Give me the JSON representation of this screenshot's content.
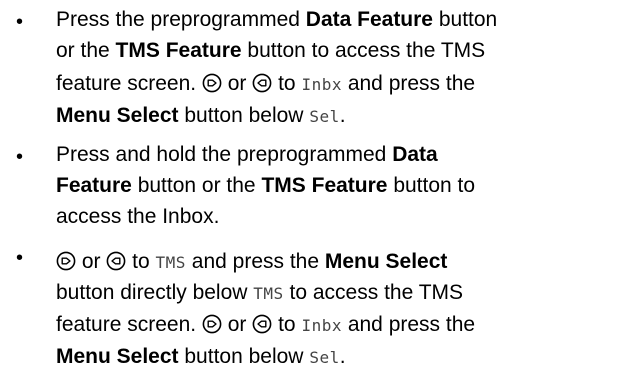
{
  "bullet_char": "•",
  "item1": {
    "l1": {
      "a": "Press the preprogrammed ",
      "b": "Data Feature",
      "c": " button"
    },
    "l2": {
      "a": "or the ",
      "b": "TMS Feature",
      "c": " button to access the TMS"
    },
    "l3": {
      "a": "feature screen. ",
      "or": " or ",
      "to": " to ",
      "code": "Inbx",
      "rest": " and press the"
    },
    "l4": {
      "b": "Menu Select",
      "a": " button below ",
      "code": "Sel",
      "end": "."
    }
  },
  "item2": {
    "l1": {
      "a": "Press and hold the preprogrammed ",
      "b": "Data"
    },
    "l2": {
      "b": "Feature",
      "a": " button or the ",
      "b2": "TMS Feature",
      "c": " button to"
    },
    "l3": {
      "a": "access the Inbox."
    }
  },
  "item3": {
    "l1": {
      "or": " or ",
      "to": " to ",
      "code": "TMS",
      "a": " and press the ",
      "b": "Menu Select"
    },
    "l2": {
      "a": "button directly below ",
      "code": "TMS",
      "c": " to access the TMS"
    },
    "l3": {
      "a": "feature screen. ",
      "or": " or ",
      "to": " to ",
      "code": "Inbx",
      "rest": " and press the"
    },
    "l4": {
      "b": "Menu Select",
      "a": " button below ",
      "code": "Sel",
      "end": "."
    }
  },
  "icons": {
    "right": "navigate-right-icon",
    "left": "navigate-left-icon"
  }
}
